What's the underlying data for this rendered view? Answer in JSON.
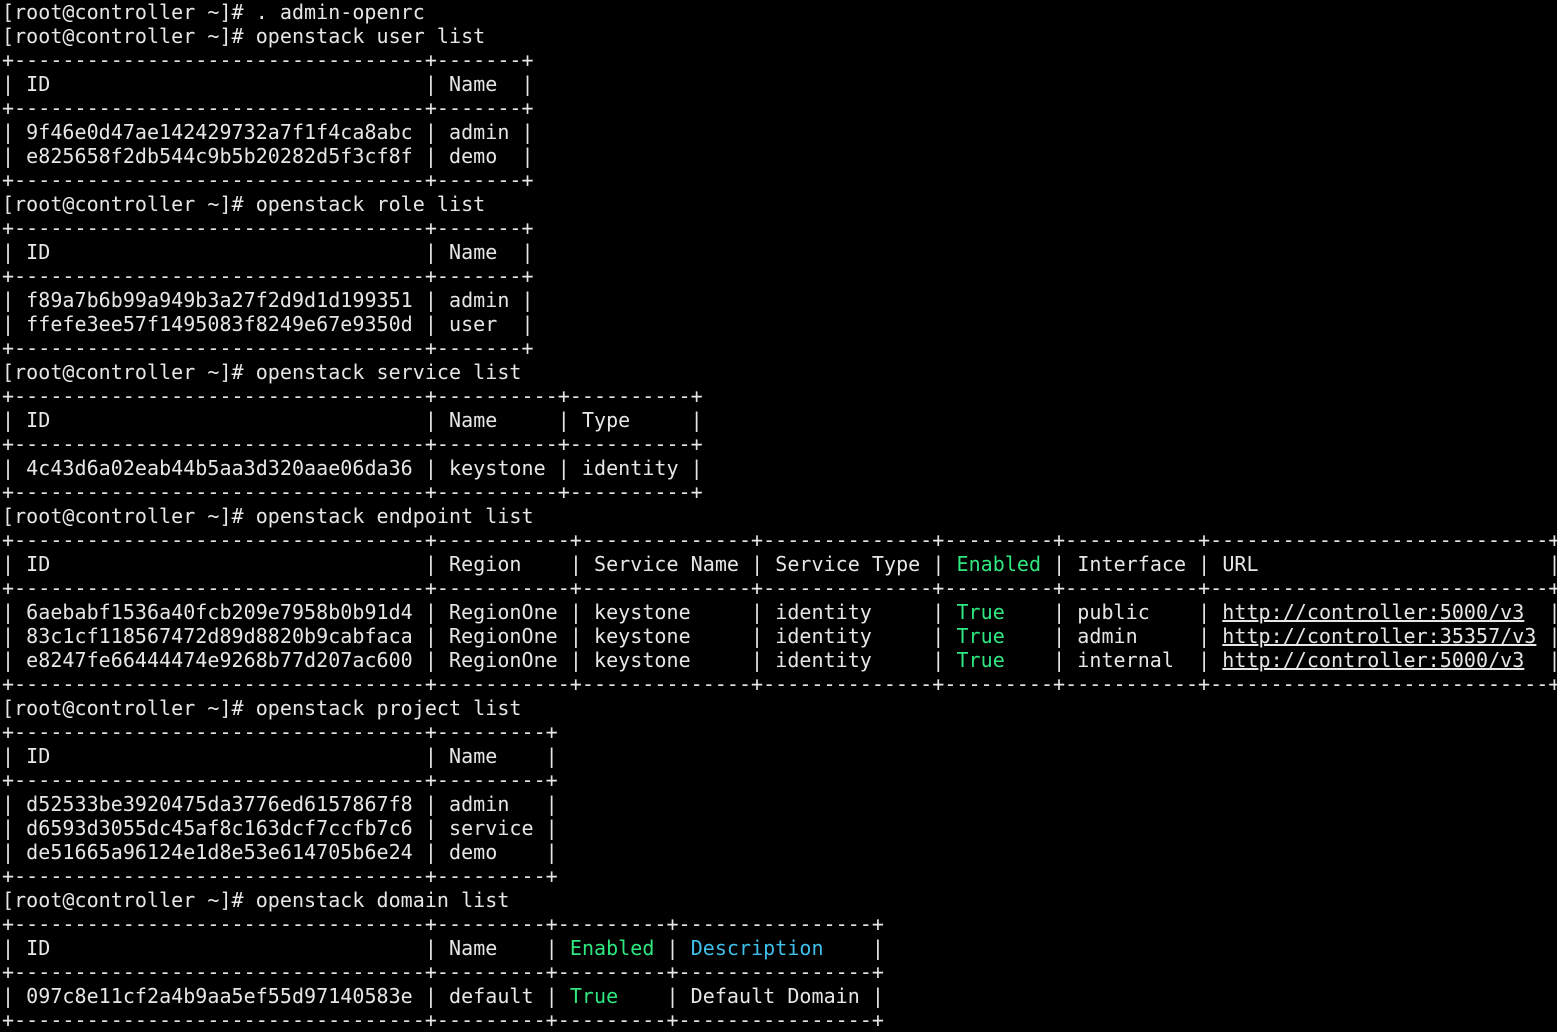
{
  "prompt": "[root@controller ~]# ",
  "colors": {
    "background": "#000000",
    "foreground": "#e6e6e6",
    "enabled_header": "#2ee87f",
    "true_value": "#2ee87f",
    "description_header": "#3fc0ea"
  },
  "commands": {
    "source": ". admin-openrc",
    "user_list": "openstack user list",
    "role_list": "openstack role list",
    "service_list": "openstack service list",
    "endpoint_list": "openstack endpoint list",
    "project_list": "openstack project list",
    "domain_list": "openstack domain list"
  },
  "user_table": {
    "headers": [
      "ID",
      "Name"
    ],
    "rows": [
      [
        "9f46e0d47ae142429732a7f1f4ca8abc",
        "admin"
      ],
      [
        "e825658f2db544c9b5b20282d5f3cf8f",
        "demo"
      ]
    ]
  },
  "role_table": {
    "headers": [
      "ID",
      "Name"
    ],
    "rows": [
      [
        "f89a7b6b99a949b3a27f2d9d1d199351",
        "admin"
      ],
      [
        "ffefe3ee57f1495083f8249e67e9350d",
        "user"
      ]
    ]
  },
  "service_table": {
    "headers": [
      "ID",
      "Name",
      "Type"
    ],
    "rows": [
      [
        "4c43d6a02eab44b5aa3d320aae06da36",
        "keystone",
        "identity"
      ]
    ]
  },
  "endpoint_table": {
    "headers": [
      "ID",
      "Region",
      "Service Name",
      "Service Type",
      "Enabled",
      "Interface",
      "URL"
    ],
    "rows": [
      [
        "6aebabf1536a40fcb209e7958b0b91d4",
        "RegionOne",
        "keystone",
        "identity",
        "True",
        "public",
        "http://controller:5000/v3"
      ],
      [
        "83c1cf118567472d89d8820b9cabfaca",
        "RegionOne",
        "keystone",
        "identity",
        "True",
        "admin",
        "http://controller:35357/v3"
      ],
      [
        "e8247fe66444474e9268b77d207ac600",
        "RegionOne",
        "keystone",
        "identity",
        "True",
        "internal",
        "http://controller:5000/v3"
      ]
    ]
  },
  "project_table": {
    "headers": [
      "ID",
      "Name"
    ],
    "rows": [
      [
        "d52533be3920475da3776ed6157867f8",
        "admin"
      ],
      [
        "d6593d3055dc45af8c163dcf7ccfb7c6",
        "service"
      ],
      [
        "de51665a96124e1d8e53e614705b6e24",
        "demo"
      ]
    ]
  },
  "domain_table": {
    "headers": [
      "ID",
      "Name",
      "Enabled",
      "Description"
    ],
    "rows": [
      [
        "097c8e11cf2a4b9aa5ef55d97140583e",
        "default",
        "True",
        "Default Domain"
      ]
    ]
  }
}
